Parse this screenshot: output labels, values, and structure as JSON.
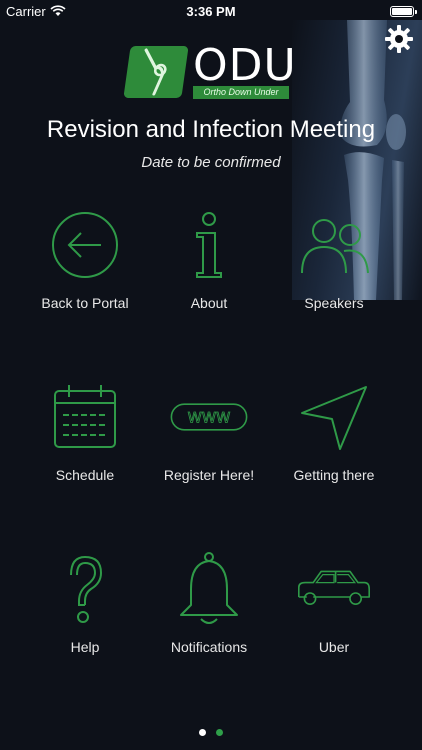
{
  "status": {
    "carrier": "Carrier",
    "time": "3:36 PM"
  },
  "logo": {
    "name": "ODU",
    "tagline": "Ortho Down Under"
  },
  "meeting": {
    "title": "Revision and Infection Meeting",
    "date": "Date to be confirmed"
  },
  "tiles": [
    {
      "label": "Back to Portal",
      "icon": "arrow-left-circle-icon"
    },
    {
      "label": "About",
      "icon": "info-icon"
    },
    {
      "label": "Speakers",
      "icon": "people-icon"
    },
    {
      "label": "Schedule",
      "icon": "calendar-icon"
    },
    {
      "label": "Register Here!",
      "icon": "www-icon"
    },
    {
      "label": "Getting there",
      "icon": "navigation-arrow-icon"
    },
    {
      "label": "Help",
      "icon": "question-icon"
    },
    {
      "label": "Notifications",
      "icon": "bell-icon"
    },
    {
      "label": "Uber",
      "icon": "car-icon"
    }
  ],
  "pager": {
    "pages": 2,
    "current": 2,
    "active_color": "#2fa04a",
    "inactive_color": "#ffffff"
  },
  "colors": {
    "accent": "#2e8b3a",
    "icon_stroke": "#2f9a48",
    "background": "#0d1119"
  }
}
